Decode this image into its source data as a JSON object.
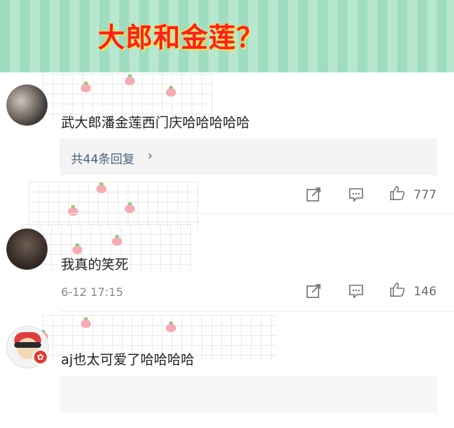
{
  "banner": {
    "title": "大郎和金莲？"
  },
  "comments": [
    {
      "text": "武大郎潘金莲西门庆哈哈哈哈哈",
      "replies_label": "共44条回复",
      "likes": "777"
    },
    {
      "text": "我真的笑死",
      "date": "6-12 17:15",
      "likes": "146"
    },
    {
      "text": "aj也太可爱了哈哈哈哈",
      "badge_icon": "flower-badge-icon"
    }
  ],
  "icons": {
    "share": "share-icon",
    "comment": "comment-icon",
    "like": "thumbs-up-icon"
  },
  "colors": {
    "banner_green": "#9fdcc0",
    "title_red": "#ff1e1e",
    "title_outline": "#f7e34a",
    "link_blue": "#48627e"
  }
}
